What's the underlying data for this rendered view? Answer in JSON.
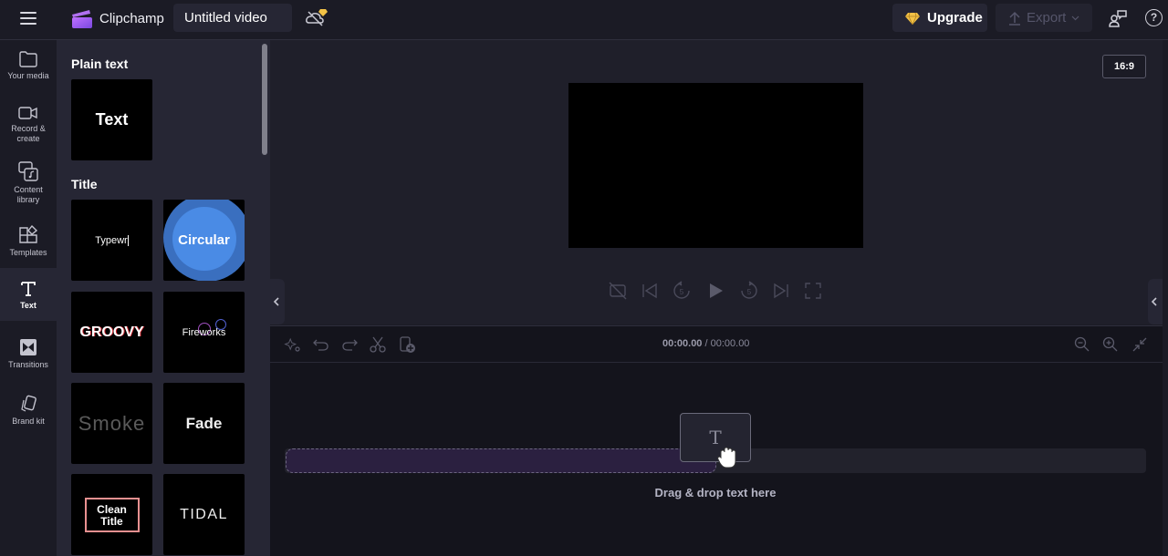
{
  "app": {
    "brand": "Clipchamp",
    "project_title": "Untitled video"
  },
  "header": {
    "upgrade_label": "Upgrade",
    "export_label": "Export",
    "help_glyph": "?",
    "accent_gold": "#f3c246"
  },
  "nav": {
    "items": [
      {
        "label": "Your media",
        "icon": "folder-icon"
      },
      {
        "label": "Record & create",
        "icon": "camera-icon"
      },
      {
        "label": "Content library",
        "icon": "content-library-icon"
      },
      {
        "label": "Templates",
        "icon": "templates-icon"
      },
      {
        "label": "Text",
        "icon": "text-icon",
        "active": true
      },
      {
        "label": "Transitions",
        "icon": "transitions-icon"
      },
      {
        "label": "Brand kit",
        "icon": "brand-kit-icon"
      }
    ],
    "record_line1": "Record &",
    "record_line2": "create",
    "content_line1": "Content",
    "content_line2": "library"
  },
  "panel": {
    "sections": [
      {
        "title": "Plain text",
        "tiles": [
          "Text"
        ]
      },
      {
        "title": "Title",
        "tiles": [
          "Typewr",
          "Circular",
          "GROOVY",
          "Fireworks",
          "Smoke",
          "Fade",
          "Clean Title",
          "TIDAL"
        ]
      }
    ],
    "clean_line1": "Clean",
    "clean_line2": "Title"
  },
  "preview": {
    "aspect_ratio": "16:9"
  },
  "timeline": {
    "current_time": "00:00.00",
    "separator": " / ",
    "total_time": "00:00.00",
    "drag_glyph": "T",
    "drop_hint": "Drag & drop text here"
  }
}
